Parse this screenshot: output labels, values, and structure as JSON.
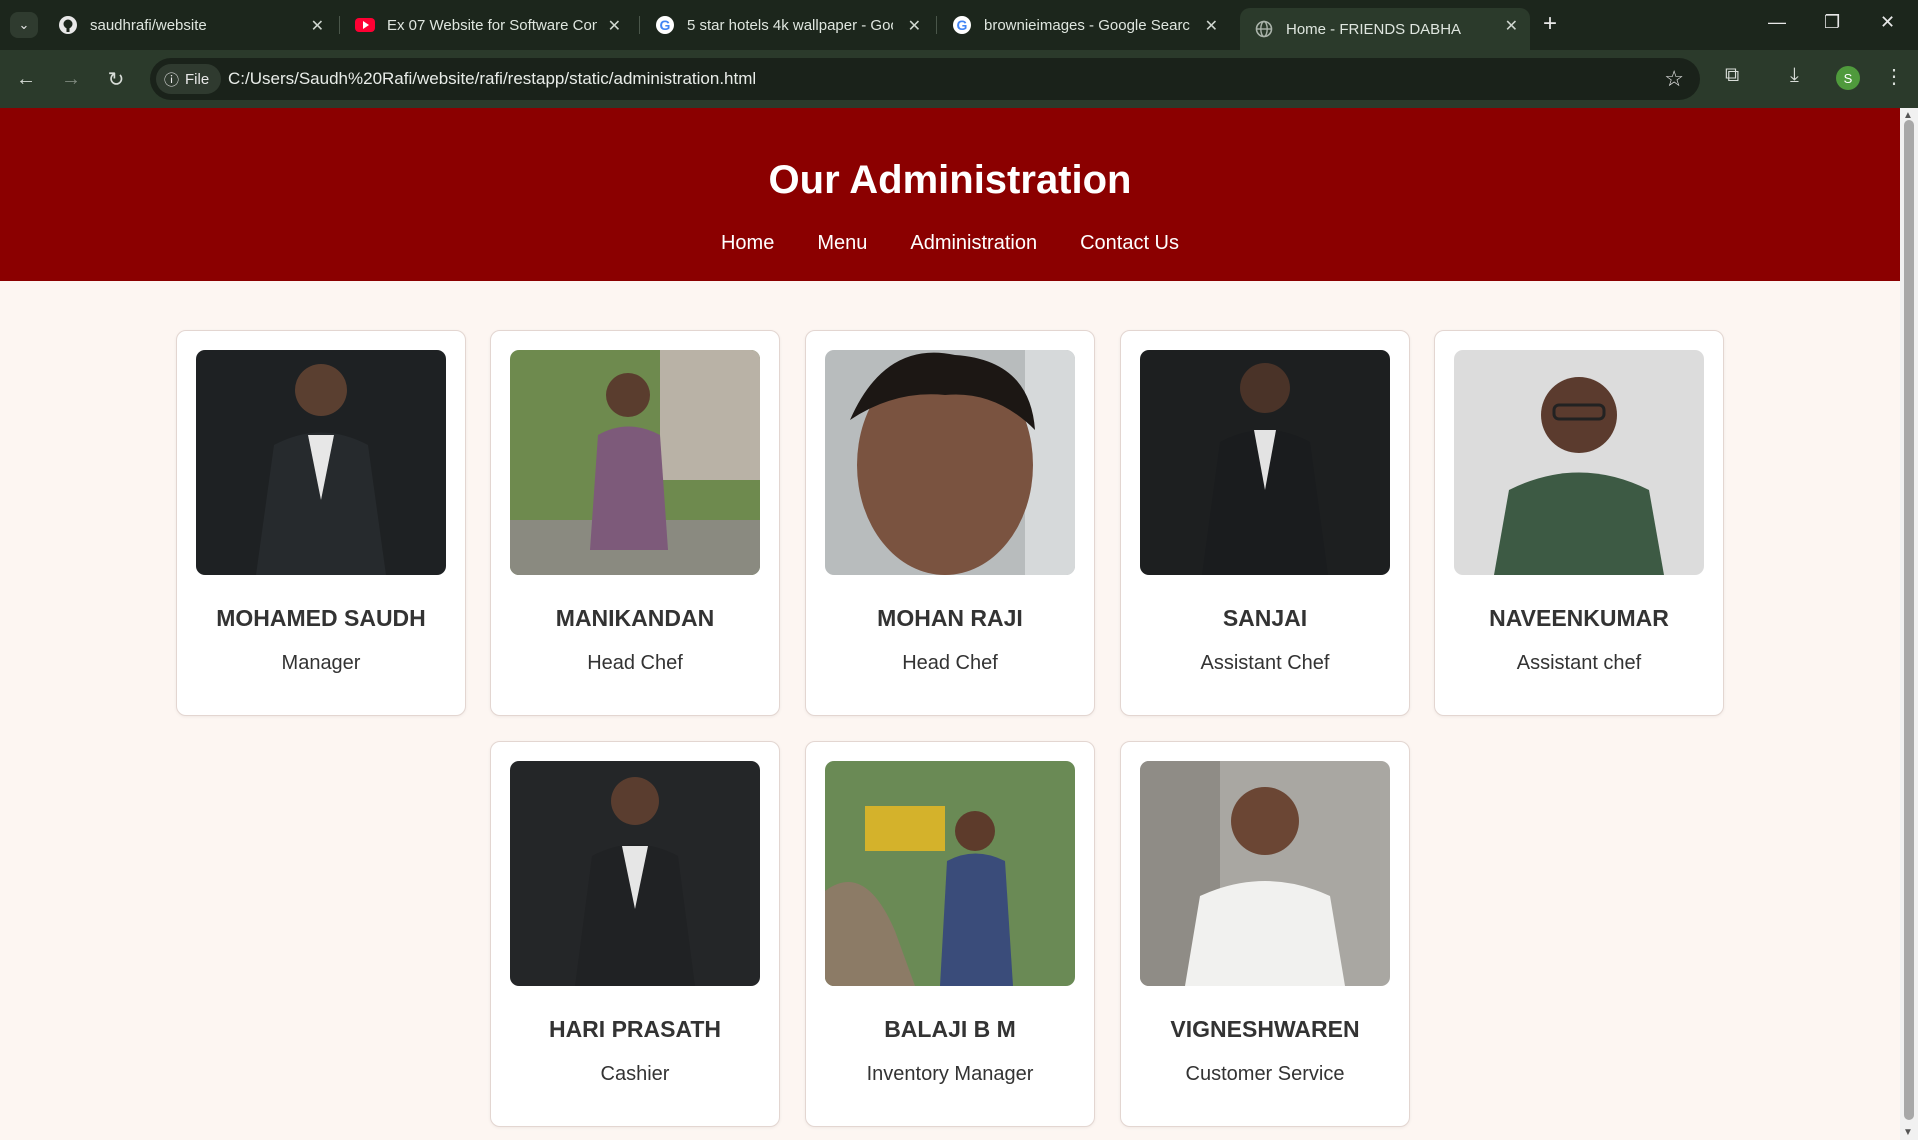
{
  "browser": {
    "tabs": [
      {
        "title": "saudhrafi/website",
        "icon": "github-icon"
      },
      {
        "title": "Ex 07 Website for Software Con",
        "icon": "youtube-icon"
      },
      {
        "title": "5 star hotels 4k wallpaper - Goo",
        "icon": "google-icon"
      },
      {
        "title": "brownieimages - Google Search",
        "icon": "google-icon"
      },
      {
        "title": "Home - FRIENDS DABHA",
        "icon": "globe-icon",
        "active": true
      }
    ],
    "file_chip": "File",
    "url": "C:/Users/Saudh%20Rafi/website/rafi/restapp/static/administration.html",
    "profile_initial": "S"
  },
  "page": {
    "title": "Our Administration",
    "nav": [
      "Home",
      "Menu",
      "Administration",
      "Contact Us"
    ],
    "header_color": "#8b0000",
    "background": "#fdf6f2"
  },
  "staff": [
    {
      "name": "MOHAMED SAUDH",
      "role": "Manager"
    },
    {
      "name": "MANIKANDAN",
      "role": "Head Chef"
    },
    {
      "name": "MOHAN RAJI",
      "role": "Head Chef"
    },
    {
      "name": "SANJAI",
      "role": "Assistant Chef"
    },
    {
      "name": "NAVEENKUMAR",
      "role": "Assistant chef"
    },
    {
      "name": "HARI PRASATH",
      "role": "Cashier"
    },
    {
      "name": "BALAJI B M",
      "role": "Inventory Manager"
    },
    {
      "name": "VIGNESHWAREN",
      "role": "Customer Service"
    }
  ]
}
